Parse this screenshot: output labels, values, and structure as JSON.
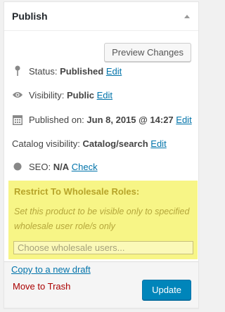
{
  "box": {
    "title": "Publish"
  },
  "preview_button": "Preview Changes",
  "status": {
    "label": "Status:",
    "value": "Published",
    "edit": "Edit"
  },
  "visibility": {
    "label": "Visibility:",
    "value": "Public",
    "edit": "Edit"
  },
  "published_on": {
    "label": "Published on:",
    "value": "Jun 8, 2015 @ 14:27",
    "edit": "Edit"
  },
  "catalog": {
    "label": "Catalog visibility:",
    "value": "Catalog/search",
    "edit": "Edit"
  },
  "seo": {
    "label": "SEO:",
    "value": "N/A",
    "check": "Check"
  },
  "wholesale": {
    "title": "Restrict To Wholesale Roles:",
    "description": "Set this product to be visible only to specified wholesale user role/s only",
    "placeholder": "Choose wholesale users..."
  },
  "actions": {
    "copy": "Copy to a new draft",
    "trash": "Move to Trash",
    "update": "Update"
  },
  "colors": {
    "link": "#0073aa",
    "trash": "#a00",
    "primary": "#0085ba",
    "highlight": "#f7f586",
    "seo_dot": "#888888"
  }
}
